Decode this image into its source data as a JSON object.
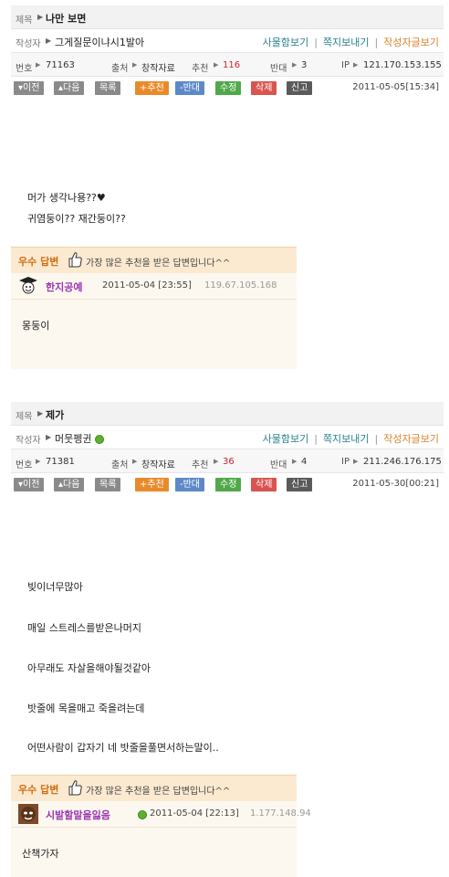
{
  "post1": {
    "title_label": "제목",
    "title": "나만 보면",
    "author_label": "작성자",
    "author": "그게질문이냐시1발아",
    "links": [
      "사물함보기",
      "쪽지보내기",
      "작성자글보기"
    ],
    "num_label": "번호",
    "num": "71163",
    "source_label": "출처",
    "source": "창작자료",
    "recommend_label": "추천",
    "recommend": "116",
    "oppose_label": "반대",
    "oppose": "3",
    "ip_label": "IP",
    "ip": "121.170.153.155",
    "buttons": [
      "이전",
      "다음",
      "목록",
      "추천",
      "반대",
      "수정",
      "삭제",
      "신고"
    ],
    "date": "2011-05-05[15:34]",
    "body": [
      "머가 생각나용??♥",
      "귀염둥이?? 재간둥이??"
    ]
  },
  "answer1": {
    "best_label": "우수 답변",
    "desc": "가장 많은 추천을 받은 답변입니다^^",
    "nick": "한지공예",
    "date": "2011-05-04 [23:55]",
    "ip": "119.67.105.168",
    "text": "몽둥이"
  },
  "post2": {
    "title_label": "제목",
    "title": "제가",
    "author_label": "작성자",
    "author": "머뭇펭귄",
    "links": [
      "사물함보기",
      "쪽지보내기",
      "작성자글보기"
    ],
    "num_label": "번호",
    "num": "71381",
    "source_label": "출처",
    "source": "창작자료",
    "recommend_label": "추천",
    "recommend": "36",
    "oppose_label": "반대",
    "oppose": "4",
    "ip_label": "IP",
    "ip": "211.246.176.175",
    "buttons": [
      "이전",
      "다음",
      "목록",
      "추천",
      "반대",
      "수정",
      "삭제",
      "신고"
    ],
    "date": "2011-05-30[00:21]",
    "body": [
      "빚이너무많아",
      "매일 스트레스를받은나머지",
      "아무래도 자살을해야될것같아",
      "밧줄에 목을매고 죽을려는데",
      "어떤사람이 갑자기 네 밧줄을풀면서하는말이.."
    ]
  },
  "answer2": {
    "best_label": "우수 답변",
    "desc": "가장 많은 추천을 받은 답변입니다^^",
    "nick": "시발할말을잃음",
    "date": "2011-05-04 [22:13]",
    "ip": "1.177.148.94",
    "text": "산책가자"
  },
  "colors": {
    "link_teal": "#2a7f8c",
    "link_orange": "#d9822b",
    "best_orange": "#d06e12",
    "nick_purple": "#9a35b5"
  }
}
